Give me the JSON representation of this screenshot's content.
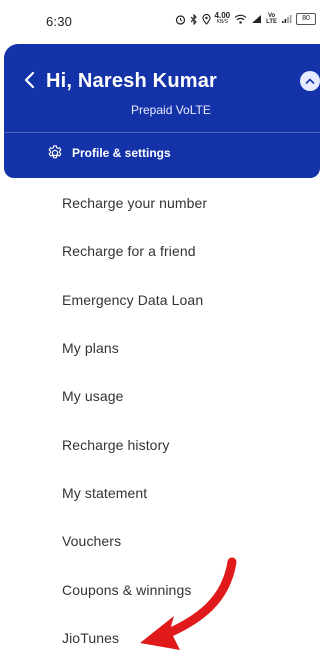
{
  "statusbar": {
    "time": "6:30",
    "net_speed_value": "4.00",
    "net_speed_unit": "KB/S",
    "volte_top": "Vo",
    "volte_bottom": "LTE",
    "battery": "80",
    "icons": [
      "alarm-icon",
      "bluetooth-icon",
      "location-icon",
      "wifi-icon",
      "signal-icon",
      "signal-icon-2",
      "battery-icon"
    ]
  },
  "header": {
    "greeting": "Hi, Naresh Kumar",
    "plan_type": "Prepaid VoLTE",
    "profile_settings_label": "Profile & settings",
    "background_color": "#1433a8"
  },
  "menu": {
    "items": [
      {
        "label": "Recharge your number"
      },
      {
        "label": "Recharge for a friend"
      },
      {
        "label": "Emergency Data Loan"
      },
      {
        "label": "My plans"
      },
      {
        "label": "My usage"
      },
      {
        "label": "Recharge history"
      },
      {
        "label": "My statement"
      },
      {
        "label": "Vouchers"
      },
      {
        "label": "Coupons & winnings"
      },
      {
        "label": "JioTunes"
      }
    ]
  },
  "annotation": {
    "arrow_color": "#e01a1a",
    "points_to": "JioTunes"
  }
}
